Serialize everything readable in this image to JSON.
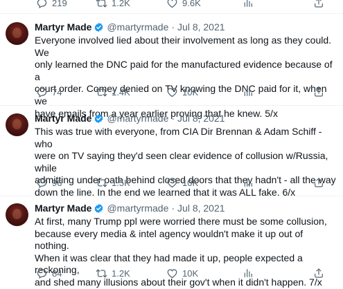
{
  "top_actions": {
    "reply_count": "219",
    "retweet_count": "1.2K",
    "like_count": "9.6K"
  },
  "tweets": [
    {
      "display_name": "Martyr Made",
      "handle": "@martyrmade",
      "separator": "·",
      "date": "Jul 8, 2021",
      "line1": "Everyone involved lied about their involvement as long as they could. We",
      "line2": "only learned the DNC paid for the manufactured evidence because of a",
      "line3": "court order. Comey denied on TV knowing the DNC paid for it, when we",
      "line4": "have emails from a year earlier proving that he knew. 5/x",
      "reply_count": "74",
      "retweet_count": "1.4K",
      "like_count": "10K"
    },
    {
      "display_name": "Martyr Made",
      "handle": "@martyrmade",
      "separator": "·",
      "date": "Jul 8, 2021",
      "line1": "This was true with everyone, from CIA Dir Brennan & Adam Schiff - who",
      "line2": "were on TV saying they'd seen clear evidence of collusion w/Russia, while",
      "line3": "admitting under oath behind closed doors that they hadn't - all the way",
      "line4": "down the line. In the end we learned that it was ALL fake. 6/x",
      "reply_count": "96",
      "retweet_count": "1.5K",
      "like_count": "10K"
    },
    {
      "display_name": "Martyr Made",
      "handle": "@martyrmade",
      "separator": "·",
      "date": "Jul 8, 2021",
      "line1": "At first, many Trump ppl were worried there must be some collusion,",
      "line2": "because every media & intel agency wouldn't make it up out of nothing.",
      "line3": "When it was clear that they had made it up, people expected a reckoning,",
      "line4": "and shed many illusions about their gov't when it didn't happen. 7/x",
      "reply_count": "84",
      "retweet_count": "1.2K",
      "like_count": "10K"
    }
  ],
  "colors": {
    "text": "#0f1419",
    "secondary": "#536471",
    "verified": "#1d9bf0",
    "divider": "#eff3f4"
  },
  "icons": [
    "reply-icon",
    "retweet-icon",
    "like-icon",
    "views-icon",
    "share-icon",
    "verified-badge-icon"
  ]
}
